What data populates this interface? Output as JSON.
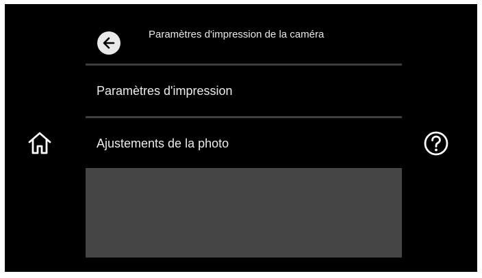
{
  "header": {
    "back_icon": "arrow-left-icon",
    "title": "Paramètres d'impression de la caméra"
  },
  "menu": {
    "items": [
      {
        "label": "Paramètres d'impression"
      },
      {
        "label": "Ajustements de la photo"
      }
    ]
  },
  "side": {
    "home_icon": "home-icon",
    "help_icon": "help-icon"
  },
  "colors": {
    "background": "#000000",
    "text": "#e8e8e8",
    "divider": "#3f3f3f",
    "panel": "#454545",
    "back_button": "#e9e9e9"
  }
}
